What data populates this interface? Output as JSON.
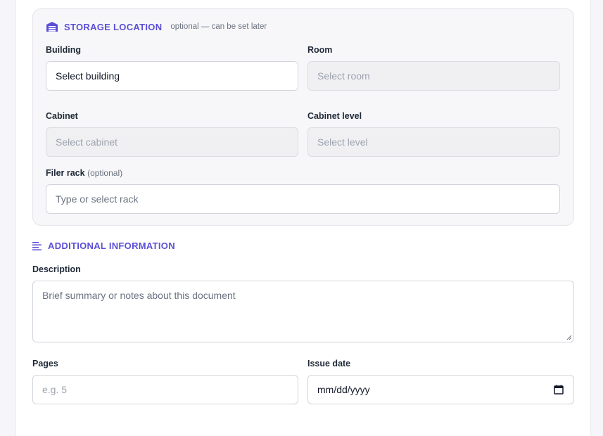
{
  "storage": {
    "title": "STORAGE LOCATION",
    "note": "optional — can be set later",
    "building": {
      "label": "Building",
      "value": "Select building"
    },
    "room": {
      "label": "Room",
      "placeholder": "Select room"
    },
    "cabinet": {
      "label": "Cabinet",
      "placeholder": "Select cabinet"
    },
    "cabinet_level": {
      "label": "Cabinet level",
      "placeholder": "Select level"
    },
    "filer_rack": {
      "label": "Filer rack",
      "optional": "(optional)",
      "placeholder": "Type or select rack"
    }
  },
  "additional": {
    "title": "ADDITIONAL INFORMATION",
    "description": {
      "label": "Description",
      "placeholder": "Brief summary or notes about this document"
    },
    "pages": {
      "label": "Pages",
      "placeholder": "e.g. 5"
    },
    "issue_date": {
      "label": "Issue date",
      "value": "mm/dd/yyyy"
    }
  },
  "colors": {
    "accent": "#5b4fd6",
    "disabled_bg": "#f0f0f2"
  },
  "icons": {
    "storage": "warehouse-icon",
    "additional": "align-left-icon",
    "date": "calendar-icon"
  }
}
